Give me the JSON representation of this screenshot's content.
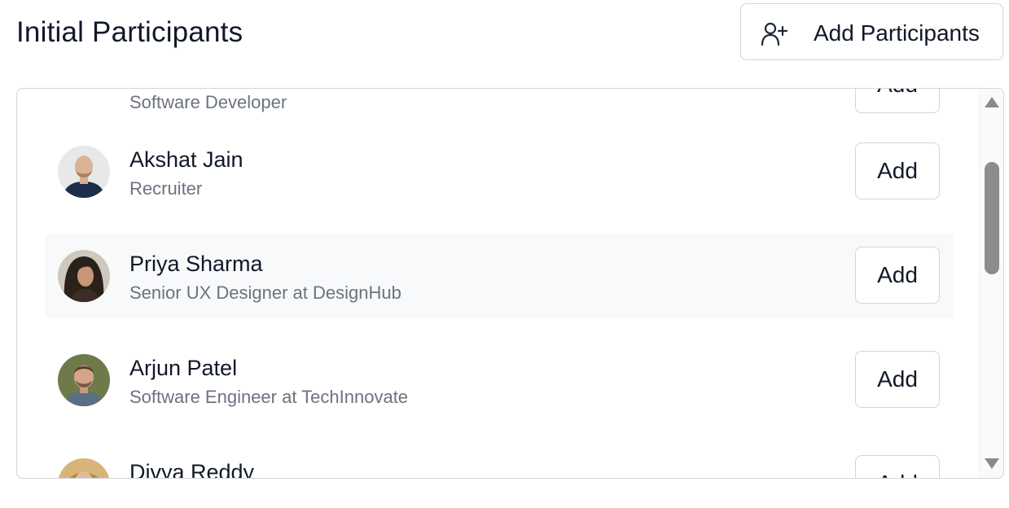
{
  "header": {
    "title": "Initial Participants",
    "add_participants_label": "Add Participants",
    "add_participants_icon": "user-plus-icon"
  },
  "participants": [
    {
      "name": "",
      "role": "Software Developer",
      "action": "Add"
    },
    {
      "name": "Akshat Jain",
      "role": "Recruiter",
      "action": "Add"
    },
    {
      "name": "Priya Sharma",
      "role": "Senior UX Designer at DesignHub",
      "action": "Add",
      "highlighted": true
    },
    {
      "name": "Arjun Patel",
      "role": "Software Engineer at TechInnovate",
      "action": "Add"
    },
    {
      "name": "Divya Reddy",
      "role": "",
      "action": "Add"
    }
  ],
  "scrollbar": {
    "up_icon": "arrow-up-icon",
    "down_icon": "arrow-down-icon"
  },
  "colors": {
    "text_primary": "#111827",
    "text_secondary": "#6b7280",
    "border": "#d1d5db",
    "row_highlight": "#f8f9fb",
    "scroll_thumb": "#8c8c8c"
  }
}
